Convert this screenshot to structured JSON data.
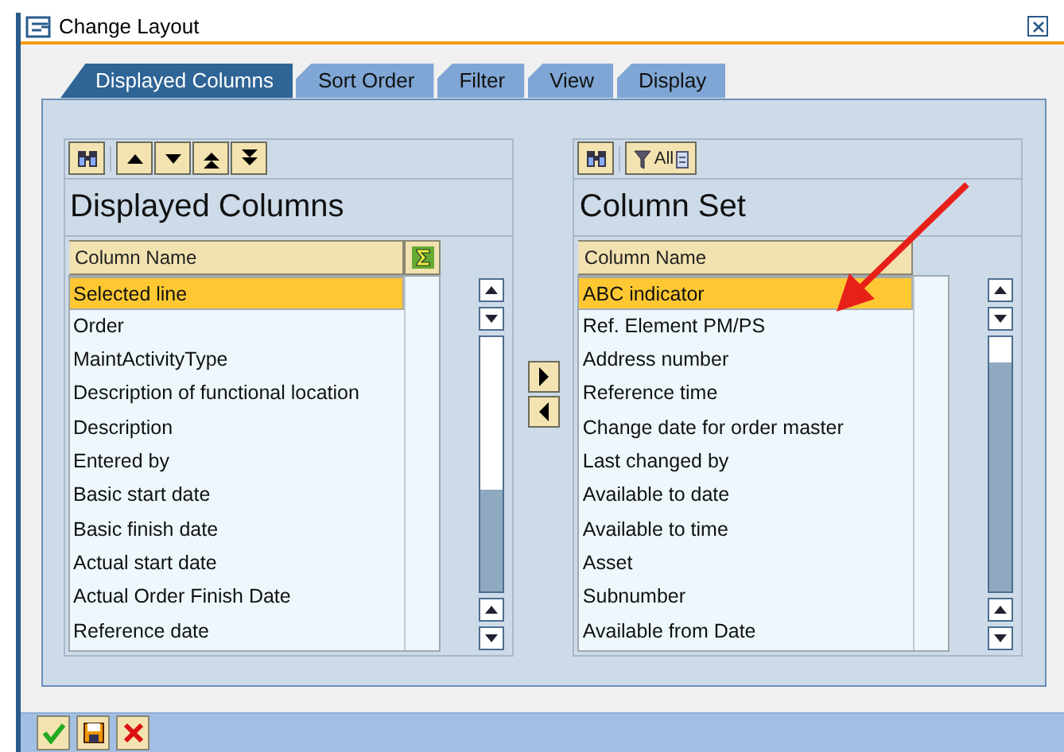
{
  "window": {
    "title": "Change Layout"
  },
  "tabs": [
    {
      "label": "Displayed Columns",
      "selected": true
    },
    {
      "label": "Sort Order",
      "selected": false
    },
    {
      "label": "Filter",
      "selected": false
    },
    {
      "label": "View",
      "selected": false
    },
    {
      "label": "Display",
      "selected": false
    }
  ],
  "panels": [
    {
      "title": "Displayed Columns",
      "header": "Column Name",
      "sum_column": true,
      "rows": [
        {
          "label": "Selected line",
          "selected": true
        },
        {
          "label": "Order",
          "selected": false
        },
        {
          "label": "MaintActivityType",
          "selected": false
        },
        {
          "label": "Description of functional location",
          "selected": false
        },
        {
          "label": "Description",
          "selected": false
        },
        {
          "label": "Entered by",
          "selected": false
        },
        {
          "label": "Basic start date",
          "selected": false
        },
        {
          "label": "Basic finish date",
          "selected": false
        },
        {
          "label": "Actual start date",
          "selected": false
        },
        {
          "label": "Actual Order Finish Date",
          "selected": false
        },
        {
          "label": "Reference date",
          "selected": false
        }
      ]
    },
    {
      "title": "Column Set",
      "header": "Column Name",
      "filter_label": "All",
      "sum_column": false,
      "rows": [
        {
          "label": "ABC indicator",
          "selected": true
        },
        {
          "label": "Ref. Element PM/PS",
          "selected": false
        },
        {
          "label": "Address number",
          "selected": false
        },
        {
          "label": "Reference time",
          "selected": false
        },
        {
          "label": "Change date for order master",
          "selected": false
        },
        {
          "label": "Last changed by",
          "selected": false
        },
        {
          "label": "Available to date",
          "selected": false
        },
        {
          "label": "Available to time",
          "selected": false
        },
        {
          "label": "Asset",
          "selected": false
        },
        {
          "label": "Subnumber",
          "selected": false
        },
        {
          "label": "Available from Date",
          "selected": false
        }
      ]
    }
  ]
}
